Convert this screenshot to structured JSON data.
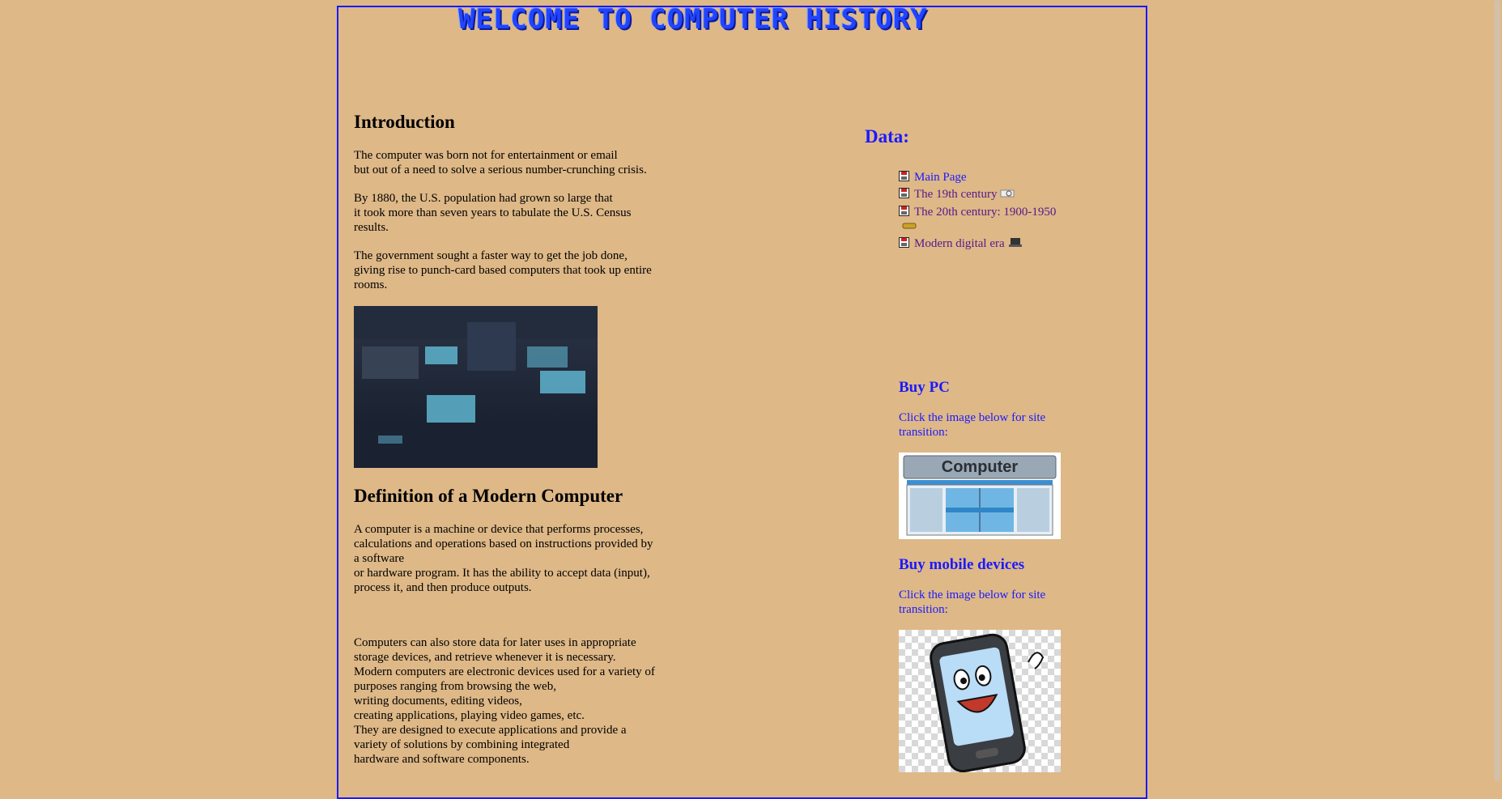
{
  "banner": {
    "title": "WELCOME TO COMPUTER HISTORY"
  },
  "intro": {
    "heading": "Introduction",
    "p1a": "The computer was born not for entertainment or email",
    "p1b": "but out of a need to solve a serious number-crunching crisis.",
    "p2a": "By 1880, the U.S. population had grown so large that",
    "p2b": "it took more than seven years to tabulate the U.S. Census",
    "p2c": "results.",
    "p3a": "The government sought a faster way to get the job done,",
    "p3b": "giving rise to punch-card based computers that took up entire",
    "p3c": "rooms."
  },
  "definition": {
    "heading": "Definition of a Modern Computer",
    "p1a": "A computer is a machine or device that performs processes,",
    "p1b": "calculations and operations based on instructions provided by",
    "p1c": "a software",
    "p1d": "or hardware program. It has the ability to accept data (input),",
    "p1e": "process it, and then produce outputs.",
    "p2a": "Computers can also store data for later uses in appropriate",
    "p2b": "storage devices, and retrieve whenever it is necessary.",
    "p2c": "Modern computers are electronic devices used for a variety of",
    "p2d": "purposes ranging from browsing the web,",
    "p2e": "writing documents, editing videos,",
    "p2f": "creating applications, playing video games, etc.",
    "p2g": "They are designed to execute applications and provide a",
    "p2h": "variety of solutions by combining integrated",
    "p2i": "hardware and software components."
  },
  "sidebar": {
    "heading": "Data:",
    "items": [
      {
        "label": "Main Page",
        "icon": "floppy-disk-icon"
      },
      {
        "label": "The 19th century",
        "icon": "floppy-disk-icon"
      },
      {
        "label": "The 20th century: 1900-1950",
        "icon": "floppy-disk-icon"
      },
      {
        "label": "Modern digital era",
        "icon": "floppy-disk-icon"
      }
    ]
  },
  "buy_pc": {
    "heading": "Buy PC",
    "hint": "Click the image below for site transition:",
    "image_text": "Computer"
  },
  "buy_mobile": {
    "heading": "Buy mobile devices",
    "hint": "Click the image below for site transition:"
  },
  "colors": {
    "background": "#deb887",
    "link": "#1a1aff",
    "visited": "#551a8b",
    "frame": "#1a1aff"
  }
}
